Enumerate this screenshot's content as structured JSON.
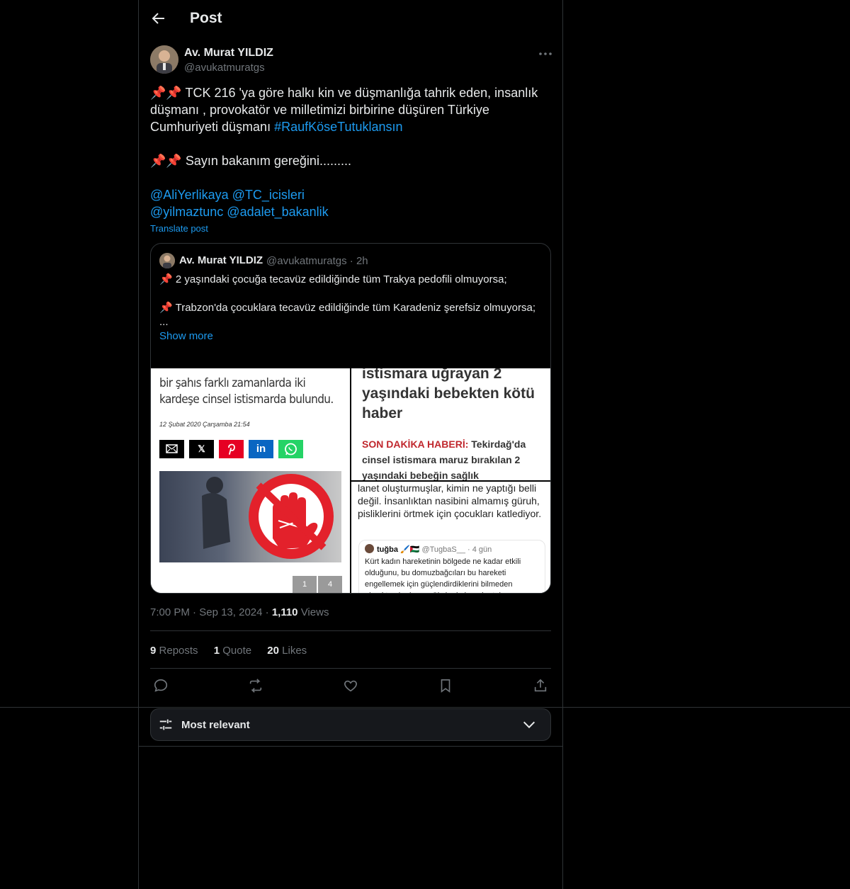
{
  "header": {
    "title": "Post"
  },
  "post": {
    "author_name": "Av. Murat YILDIZ",
    "author_handle": "@avukatmuratgs",
    "line1_emoji": "📌📌",
    "line1_text": " TCK 216 'ya göre halkı kin ve düşmanlığa tahrik eden,  insanlık düşmanı , provokatör ve milletimizi birbirine düşüren Türkiye Cumhuriyeti düşmanı ",
    "hashtag": "#RaufKöseTutuklansın",
    "line2_emoji": "📌📌",
    "line2_text": " Sayın bakanım gereğini.........",
    "mentions_line1": "@AliYerlikaya @TC_icisleri",
    "mentions_line2": "@yilmaztunc @adalet_bakanlik",
    "translate": "Translate post",
    "time": "7:00 PM",
    "date": "Sep 13, 2024",
    "views_count": "1,110",
    "views_label": "Views",
    "reposts_count": "9",
    "reposts_label": "Reposts",
    "quote_count": "1",
    "quote_label": "Quote",
    "likes_count": "20",
    "likes_label": "Likes",
    "dot": "·"
  },
  "quoted": {
    "author_name": "Av. Murat YILDIZ",
    "author_handle": "@avukatmuratgs",
    "age": "2h",
    "pin": "📌",
    "line1": "2 yaşındaki çocuğa tecavüz edildiğinde tüm Trakya pedofili olmuyorsa;",
    "line2": "Trabzon'da çocuklara tecavüz edildiğinde tüm Karadeniz şerefsiz olmuyorsa;",
    "ellipsis": "...",
    "show_more": "Show more",
    "media1": {
      "headline": "bir şahıs farklı zamanlarda iki kardeşe cinsel istismarda bulundu.",
      "date": "12 Şubat 2020 Çarşamba 21:54",
      "page_a": "1",
      "page_b": "4"
    },
    "media2": {
      "headline": "istismara uğrayan 2 yaşındaki bebekten kötü haber",
      "sub_key": "SON DAKİKA HABERİ:",
      "sub_rest": " Tekirdağ'da cinsel istismara maruz bırakılan 2 yaşındaki bebeğin sağlık"
    },
    "media3": {
      "text": "lanet oluşturmuşlar, kimin ne yaptığı belli değil. İnsanlıktan nasibini almamış güruh, pisliklerini örtmek için çocukları katlediyor.",
      "inner_name": "tuğba 🖌️🇵🇸",
      "inner_handle": "@TugbaS__ · 4 gün",
      "inner_text": "Kürt kadın hareketinin bölgede ne kadar etkili olduğunu, bu domuzbağcıları bu hareketi engellemek için güçlendirdiklerini bilmeden olmaktan korkuyor. Siz kadınların kurtulmasını"
    }
  },
  "sort": {
    "label": "Most relevant"
  },
  "icons": [
    "back-arrow-icon",
    "more-icon",
    "reply-icon",
    "repost-icon",
    "like-icon",
    "bookmark-icon",
    "share-icon",
    "sliders-icon",
    "chevron-down-icon"
  ],
  "colors": {
    "accent": "#1d9bf0",
    "text": "#e7e9ea",
    "muted": "#71767b",
    "border": "#2f3336",
    "background": "#000000"
  }
}
